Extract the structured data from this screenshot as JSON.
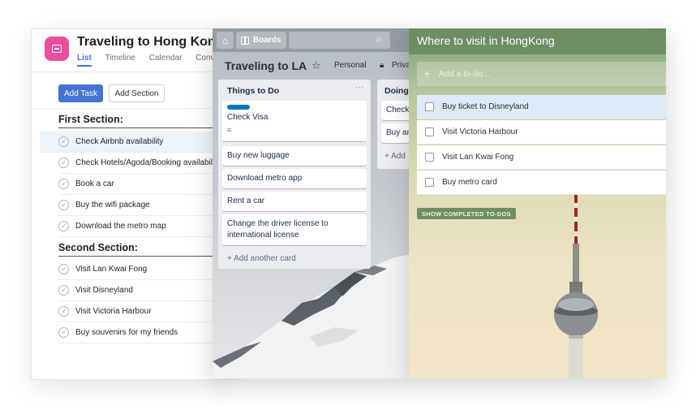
{
  "asana": {
    "title": "Traveling to Hong Kong",
    "tabs": [
      {
        "label": "List"
      },
      {
        "label": "Timeline"
      },
      {
        "label": "Calendar"
      },
      {
        "label": "Conve"
      }
    ],
    "add_task_label": "Add Task",
    "add_section_label": "Add Section",
    "sections": [
      {
        "title": "First Section:",
        "tasks": [
          {
            "label": "Check Airbnb availability"
          },
          {
            "label": "Check Hotels/Agoda/Booking availabil"
          },
          {
            "label": "Book a car"
          },
          {
            "label": "Buy the wifi package"
          },
          {
            "label": "Download the metro map"
          }
        ]
      },
      {
        "title": "Second Section:",
        "tasks": [
          {
            "label": "Visit Lan Kwai Fong"
          },
          {
            "label": "Visit Disneyland"
          },
          {
            "label": "Visit Victoria Harbour"
          },
          {
            "label": "Buy souvenirs for my friends"
          }
        ]
      }
    ]
  },
  "trello": {
    "boards_label": "Boards",
    "board_title": "Traveling to LA",
    "visibility": "Personal",
    "privacy": "Priva",
    "lists": [
      {
        "title": "Things to Do",
        "cards": [
          {
            "text": "Check Visa",
            "label_color": "#0079bf"
          },
          {
            "text": "Buy new luggage"
          },
          {
            "text": "Download metro app"
          },
          {
            "text": "Rent a car"
          },
          {
            "text": "Change the driver license to international license"
          }
        ],
        "add_card": "+ Add another card"
      },
      {
        "title": "Doing",
        "cards": [
          {
            "text": "Check"
          },
          {
            "text": "Buy an"
          }
        ],
        "add_card": "+ Add"
      }
    ]
  },
  "todo": {
    "title": "Where to visit in HongKong",
    "add_placeholder": "Add a to-do...",
    "items": [
      {
        "label": "Buy ticket to Disneyland"
      },
      {
        "label": "Visit Victoria Harbour"
      },
      {
        "label": "Visit Lan Kwai Fong"
      },
      {
        "label": "Buy metro card"
      }
    ],
    "show_completed": "SHOW COMPLETED TO-DOS"
  },
  "colors": {
    "asana_accent": "#4573d2",
    "asana_icon": "#ea4e9d",
    "trello_label": "#0079bf",
    "todo_header": "#6d8e62"
  }
}
